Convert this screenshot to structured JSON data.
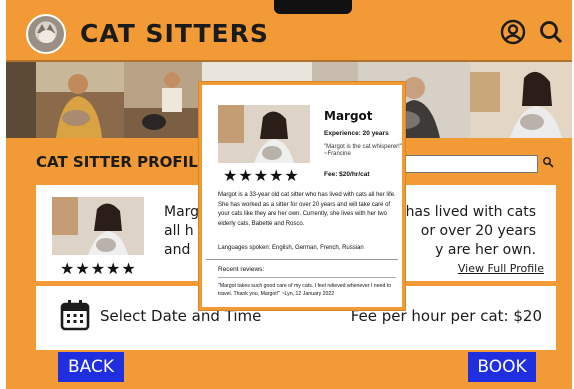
{
  "header": {
    "title": "CAT SITTERS",
    "icons": [
      "account-circle-icon",
      "search-icon"
    ]
  },
  "page": {
    "section_title": "CAT SITTER PROFIL",
    "search_placeholder": ""
  },
  "profile": {
    "name_fragment": "Marg",
    "bio_lines": [
      "all h",
      "and"
    ],
    "bio_right_lines": [
      "has lived with cats",
      "or over 20 years",
      "y are her own."
    ],
    "rating": "★★★★★",
    "view_full_profile": "View Full Profile"
  },
  "booking": {
    "select_date": "Select Date and Time",
    "fee": "Fee per hour per cat: $20"
  },
  "buttons": {
    "back": "BACK",
    "book": "BOOK"
  },
  "popup": {
    "name": "Margot",
    "experience": "Experience: 20 years",
    "quote": "\"Margot is the cat whisperer!\" ~Francine",
    "rating": "★★★★★",
    "fee": "Fee: $20/hr/cat",
    "bio": "Margot is a 33-year old cat sitter who has lived with cats all her life. She has worked as a sitter for over 20 years and will take care of your cats like they are her own. Currently, she lives with her two elderly cats, Babette and Rosco.",
    "languages": "Languages spoken: English, German, French, Russian",
    "reviews_title": "Recent reviews:",
    "review_text": "\"Margot takes such good care of my cats. I feel relieved whenever I need to travel. Thank you, Margot!\" ~Lyn, 12 January 2022"
  },
  "colors": {
    "background": "#f29a35",
    "button": "#1f2fe0",
    "card": "#ffffff"
  }
}
